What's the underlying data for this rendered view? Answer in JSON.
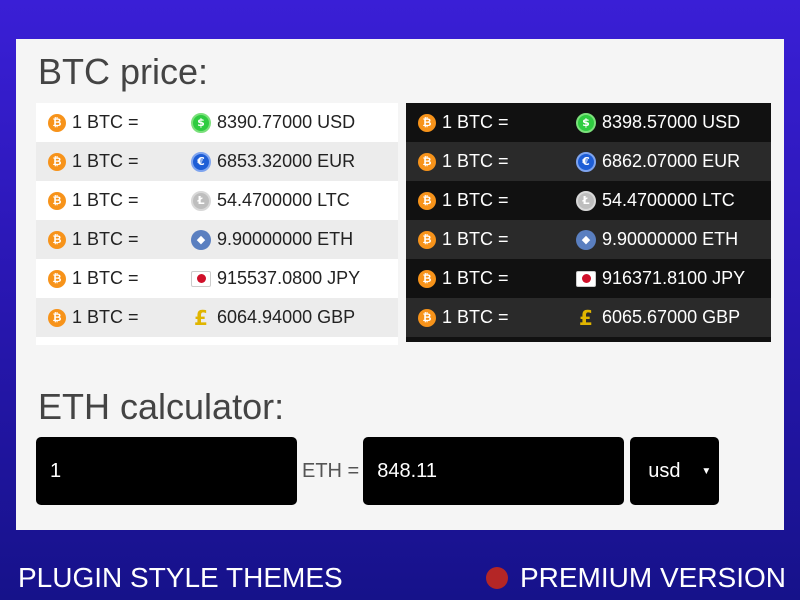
{
  "btc_section": {
    "title": "BTC price:",
    "light_rows": [
      {
        "base": "1 BTC =",
        "coin": "usd",
        "value": "8390.77000 USD"
      },
      {
        "base": "1 BTC =",
        "coin": "eur",
        "value": "6853.32000 EUR"
      },
      {
        "base": "1 BTC =",
        "coin": "ltc",
        "value": "54.4700000 LTC"
      },
      {
        "base": "1 BTC =",
        "coin": "eth",
        "value": "9.90000000 ETH"
      },
      {
        "base": "1 BTC =",
        "coin": "jpy",
        "value": "915537.0800 JPY"
      },
      {
        "base": "1 BTC =",
        "coin": "gbp",
        "value": "6064.94000 GBP"
      }
    ],
    "dark_rows": [
      {
        "base": "1 BTC =",
        "coin": "usd",
        "value": "8398.57000 USD"
      },
      {
        "base": "1 BTC =",
        "coin": "eur",
        "value": "6862.07000 EUR"
      },
      {
        "base": "1 BTC =",
        "coin": "ltc",
        "value": "54.4700000 LTC"
      },
      {
        "base": "1 BTC =",
        "coin": "eth",
        "value": "9.90000000 ETH"
      },
      {
        "base": "1 BTC =",
        "coin": "jpy",
        "value": "916371.8100 JPY"
      },
      {
        "base": "1 BTC =",
        "coin": "gbp",
        "value": "6065.67000 GBP"
      }
    ]
  },
  "eth_calculator": {
    "title": "ETH calculator:",
    "amount": "1",
    "equals_label": "ETH =",
    "result": "848.11",
    "currency": "usd"
  },
  "footer": {
    "left": "PLUGIN STYLE THEMES",
    "right": "PREMIUM VERSION"
  },
  "colors": {
    "background_top": "#3a1fd6",
    "background_bottom": "#16128a",
    "premium_dot": "#b42626",
    "btc_orange": "#f7931a"
  }
}
